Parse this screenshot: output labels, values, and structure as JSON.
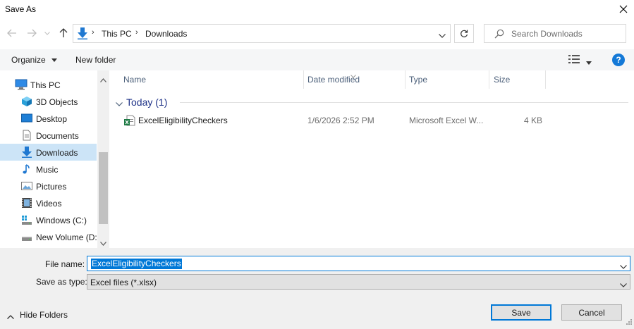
{
  "window": {
    "title": "Save As"
  },
  "address": {
    "crumbs": [
      "This PC",
      "Downloads"
    ]
  },
  "search": {
    "placeholder": "Search Downloads"
  },
  "toolbar": {
    "organize": "Organize",
    "new_folder": "New folder",
    "help": "?"
  },
  "nav": {
    "items": [
      {
        "label": "This PC",
        "icon": "computer-icon"
      },
      {
        "label": "3D Objects",
        "icon": "3d-objects-icon"
      },
      {
        "label": "Desktop",
        "icon": "desktop-icon"
      },
      {
        "label": "Documents",
        "icon": "documents-icon"
      },
      {
        "label": "Downloads",
        "icon": "downloads-icon",
        "selected": true
      },
      {
        "label": "Music",
        "icon": "music-icon"
      },
      {
        "label": "Pictures",
        "icon": "pictures-icon"
      },
      {
        "label": "Videos",
        "icon": "videos-icon"
      },
      {
        "label": "Windows (C:)",
        "icon": "drive-c-icon"
      },
      {
        "label": "New Volume (D:",
        "icon": "drive-d-icon"
      }
    ]
  },
  "files": {
    "columns": {
      "name": "Name",
      "date": "Date modified",
      "type": "Type",
      "size": "Size"
    },
    "group": "Today (1)",
    "rows": [
      {
        "name": "ExcelEligibilityCheckers",
        "date": "1/6/2026 2:52 PM",
        "type": "Microsoft Excel W...",
        "size": "4 KB",
        "icon": "excel-file-icon"
      }
    ]
  },
  "form": {
    "filename_label": "File name:",
    "filename_value": "ExcelEligibilityCheckers",
    "savetype_label": "Save as type:",
    "savetype_value": "Excel files (*.xlsx)"
  },
  "footer": {
    "hide_folders": "Hide Folders",
    "save": "Save",
    "cancel": "Cancel"
  },
  "colors": {
    "accent": "#0078d7",
    "selected": "#cce4f7",
    "group_title": "#1e3287"
  }
}
